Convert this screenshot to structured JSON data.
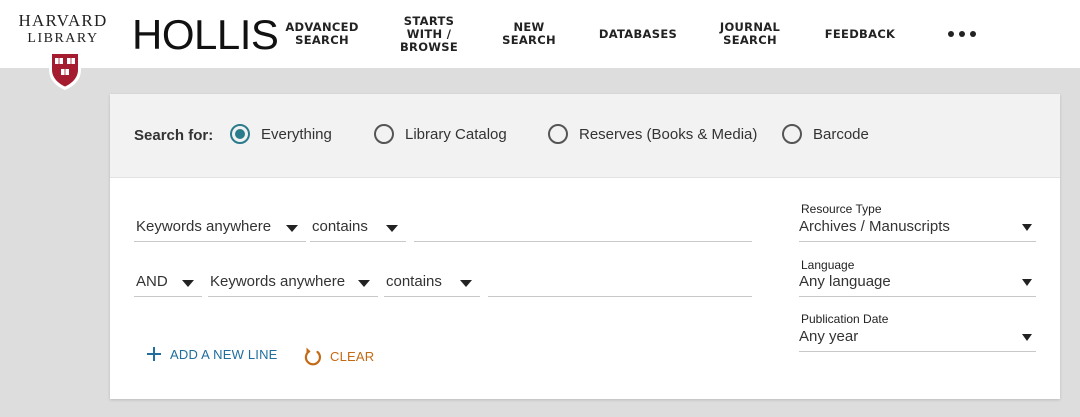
{
  "logo": {
    "line1": "HARVARD",
    "line2": "LIBRARY"
  },
  "app_title": "HOLLIS",
  "nav": [
    {
      "lines": [
        "ADVANCED",
        "SEARCH"
      ]
    },
    {
      "lines": [
        "STARTS",
        "WITH /",
        "BROWSE"
      ]
    },
    {
      "lines": [
        "NEW",
        "SEARCH"
      ]
    },
    {
      "lines": [
        "DATABASES"
      ]
    },
    {
      "lines": [
        "JOURNAL",
        "SEARCH"
      ]
    },
    {
      "lines": [
        "FEEDBACK"
      ]
    }
  ],
  "search_scope": {
    "label": "Search for:",
    "selected": "Everything",
    "options": [
      "Everything",
      "Library Catalog",
      "Reserves (Books & Media)",
      "Barcode"
    ]
  },
  "query_rows": [
    {
      "field": "Keywords anywhere",
      "condition": "contains",
      "value": ""
    },
    {
      "operator": "AND",
      "field": "Keywords anywhere",
      "condition": "contains",
      "value": ""
    }
  ],
  "actions": {
    "add_line": "ADD A NEW LINE",
    "clear": "CLEAR"
  },
  "facets": [
    {
      "label": "Resource Type",
      "value": "Archives / Manuscripts"
    },
    {
      "label": "Language",
      "value": "Any language"
    },
    {
      "label": "Publication Date",
      "value": "Any year"
    }
  ],
  "colors": {
    "accent": "#2a7c8c",
    "link": "#1f6e9e",
    "clear": "#c46a14",
    "crimson": "#a51c30"
  },
  "icons": {
    "more": "ellipsis-icon",
    "add": "plus-icon",
    "clear": "undo-icon",
    "dropdown": "caret-down-icon",
    "logo": "harvard-shield-icon"
  }
}
